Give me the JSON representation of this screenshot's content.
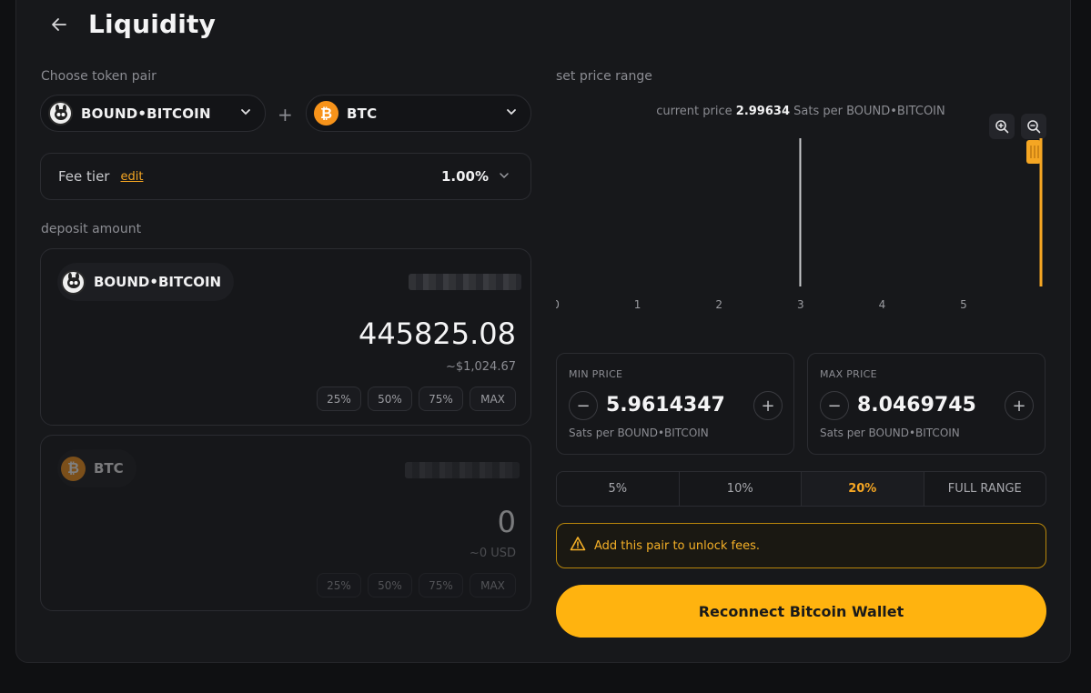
{
  "header": {
    "title": "Liquidity"
  },
  "pair_section": {
    "label": "Choose token pair",
    "token_a": "BOUND•BITCOIN",
    "token_b": "BTC",
    "plus": "+"
  },
  "fee": {
    "label": "Fee tier",
    "edit_label": "edit",
    "value": "1.00%"
  },
  "deposit": {
    "label": "deposit amount",
    "token_a": {
      "name": "BOUND•BITCOIN",
      "amount": "445825.08",
      "usd": "~$1,024.67",
      "percents": [
        "25%",
        "50%",
        "75%",
        "MAX"
      ]
    },
    "token_b": {
      "name": "BTC",
      "amount": "0",
      "usd": "~0 USD",
      "percents": [
        "25%",
        "50%",
        "75%",
        "MAX"
      ]
    }
  },
  "range_section": {
    "label": "set price range",
    "current_price_prefix": "current price",
    "current_price_value": "2.99634",
    "current_price_unit": "Sats per BOUND•BITCOIN"
  },
  "chart_data": {
    "type": "line",
    "x_ticks": [
      "0",
      "1",
      "2",
      "3",
      "4",
      "5"
    ],
    "xlim": [
      0,
      6
    ],
    "current_price": 2.99634,
    "range_marker": 5.96
  },
  "min_price": {
    "label": "MIN PRICE",
    "value": "5.9614347",
    "unit": "Sats per BOUND•BITCOIN"
  },
  "max_price": {
    "label": "MAX PRICE",
    "value": "8.0469745",
    "unit": "Sats per BOUND•BITCOIN"
  },
  "range_options": [
    "5%",
    "10%",
    "20%",
    "FULL RANGE"
  ],
  "range_active": "20%",
  "warning": {
    "text": "Add this pair to unlock fees."
  },
  "cta": {
    "label": "Reconnect Bitcoin Wallet"
  },
  "colors": {
    "accent": "#f5a623",
    "cta": "#ffb30f",
    "btc": "#f7931a"
  }
}
